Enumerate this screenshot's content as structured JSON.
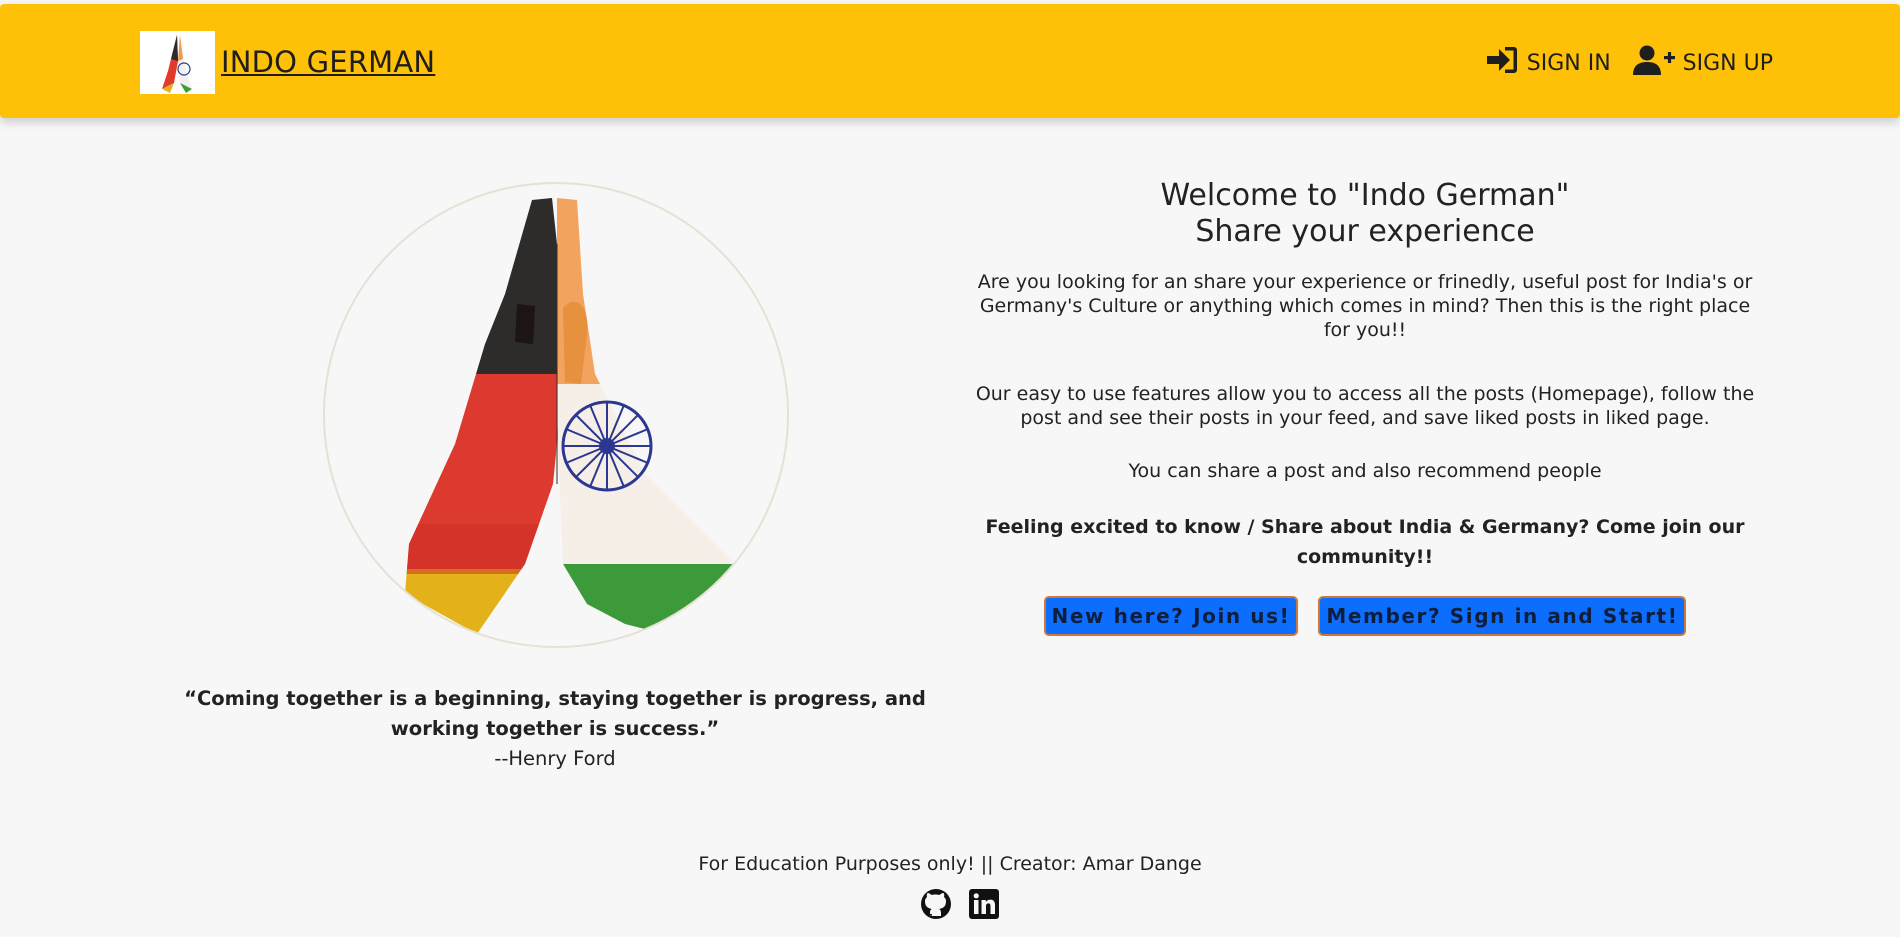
{
  "header": {
    "brand_name": "INDO GERMAN",
    "logo_icon": "namaste-hands-logo",
    "nav": [
      {
        "label": "SIGN IN",
        "icon": "sign-in-icon"
      },
      {
        "label": "SIGN UP",
        "icon": "user-plus-icon"
      }
    ],
    "bg_color": "#ffc107"
  },
  "hero": {
    "image": "namaste-hands-flags-illustration",
    "quote": "“Coming together is a beginning, staying together is progress, and working together is success.”",
    "author": "--Henry Ford"
  },
  "welcome": {
    "title_line1": "Welcome to \"Indo German\"",
    "title_line2": "Share your experience",
    "p1": "Are you looking for an share your experience or frinedly, useful post for India's or Germany's Culture or anything which comes in mind? Then this is the right place for you!!",
    "p2": "Our easy to use features allow you to access all the posts (Homepage), follow the post and see their posts in your feed, and save liked posts in liked page.",
    "p3": "You can share a post and also recommend people",
    "p4": "Feeling excited to know / Share about India & Germany? Come join our community!!",
    "buttons": [
      {
        "label": "New here? Join us!"
      },
      {
        "label": "Member? Sign in and Start!"
      }
    ],
    "button_color": "#0d6efd"
  },
  "footer": {
    "text": "For Education Purposes only! || Creator: Amar Dange",
    "icons": [
      "github-icon",
      "linkedin-icon"
    ]
  }
}
